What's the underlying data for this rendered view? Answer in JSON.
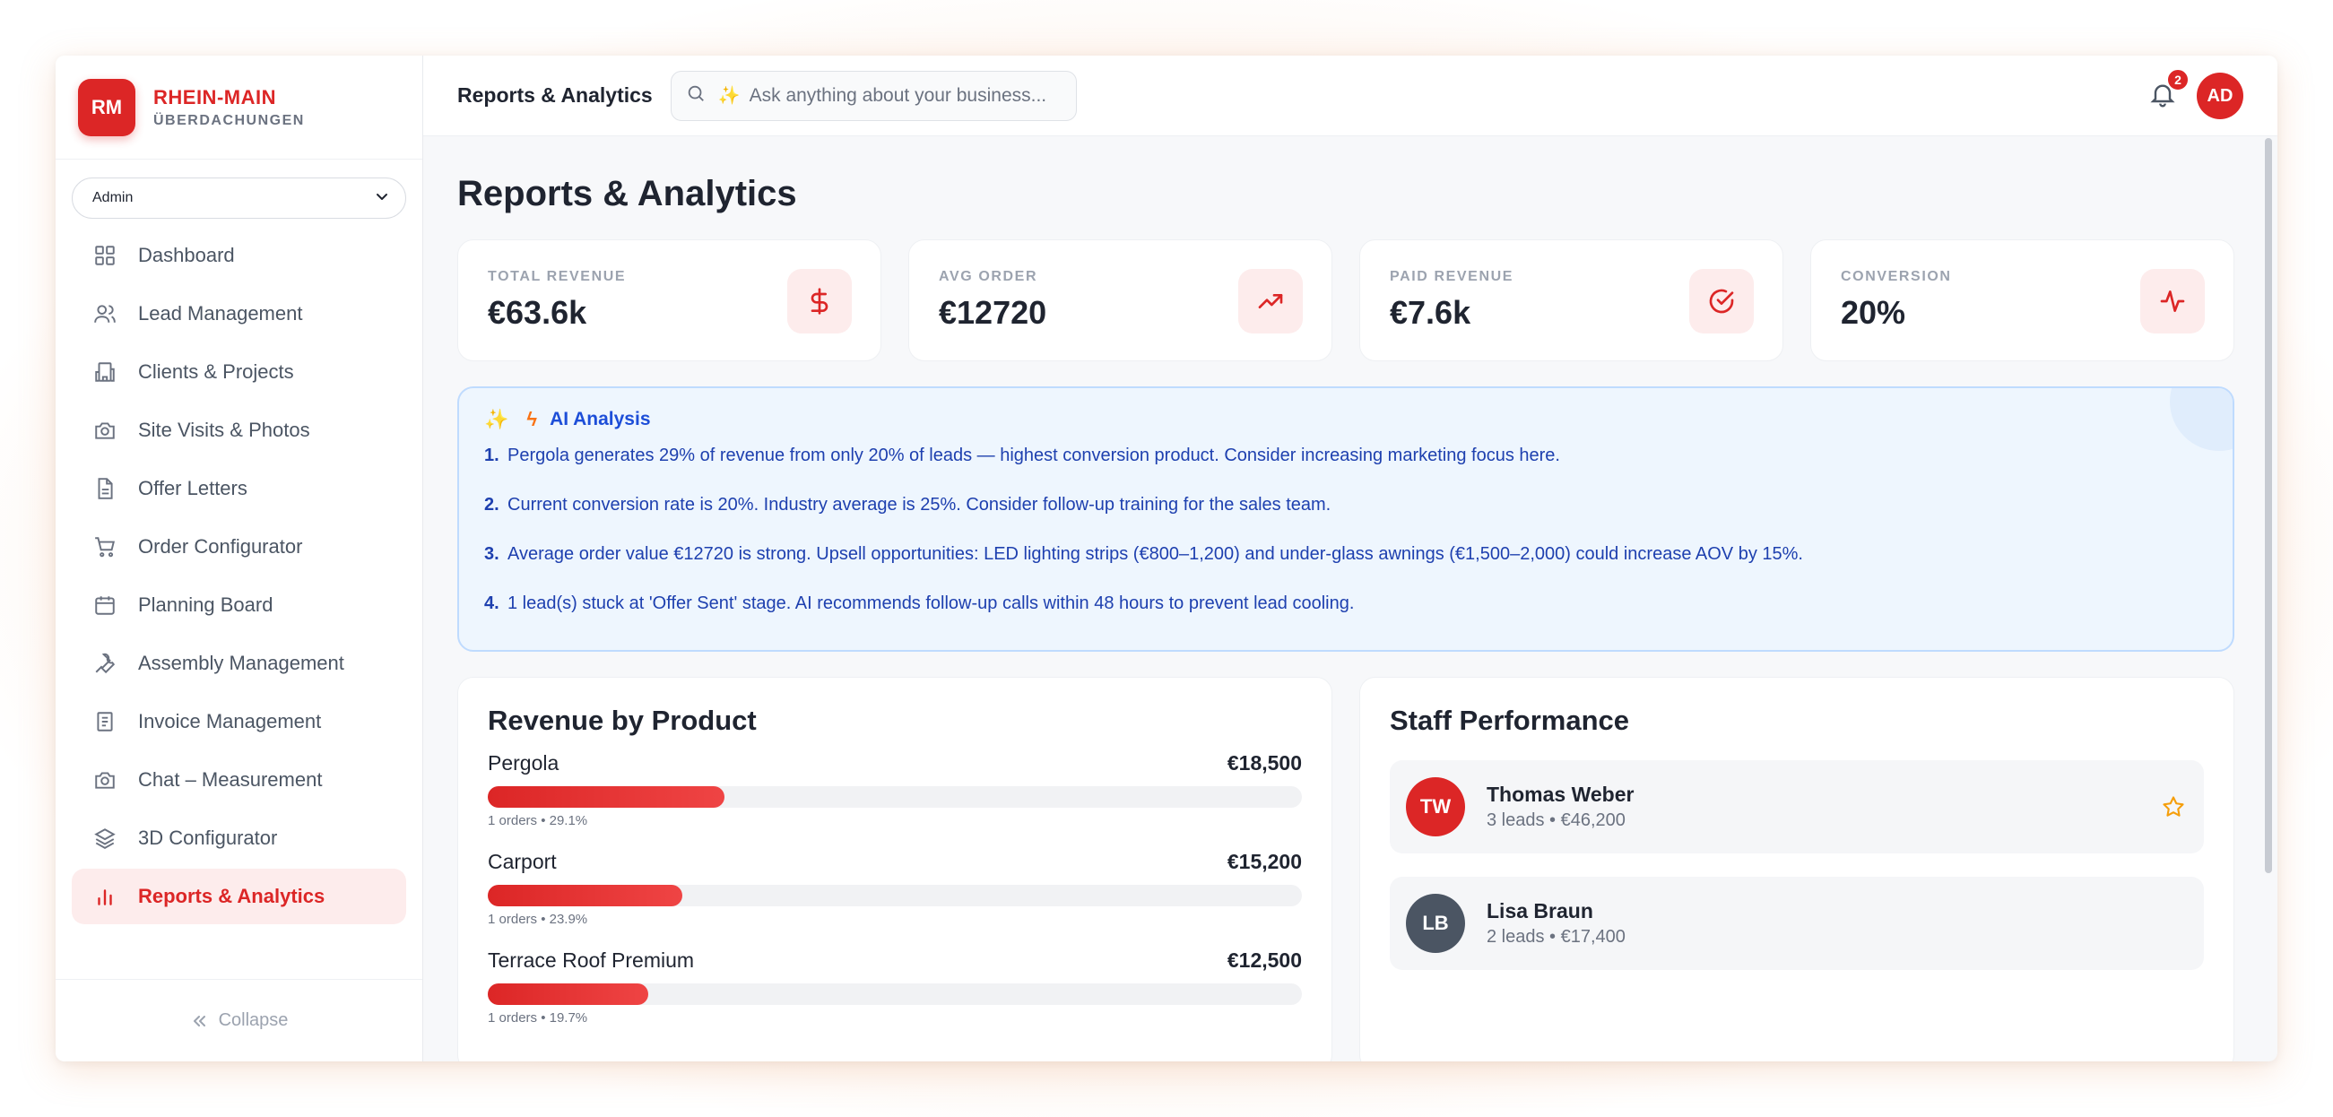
{
  "brand": {
    "initials": "RM",
    "name": "RHEIN-MAIN",
    "subtitle": "ÜBERDACHUNGEN"
  },
  "role": {
    "selected": "Admin"
  },
  "sidebar": {
    "items": [
      {
        "label": "Dashboard",
        "icon": "grid-icon"
      },
      {
        "label": "Lead Management",
        "icon": "users-icon"
      },
      {
        "label": "Clients & Projects",
        "icon": "building-icon"
      },
      {
        "label": "Site Visits & Photos",
        "icon": "camera-icon"
      },
      {
        "label": "Offer Letters",
        "icon": "document-icon"
      },
      {
        "label": "Order Configurator",
        "icon": "cart-icon"
      },
      {
        "label": "Planning Board",
        "icon": "calendar-icon"
      },
      {
        "label": "Assembly Management",
        "icon": "wrench-icon"
      },
      {
        "label": "Invoice Management",
        "icon": "receipt-icon"
      },
      {
        "label": "Chat – Measurement",
        "icon": "camera-icon"
      },
      {
        "label": "3D Configurator",
        "icon": "layers-icon"
      },
      {
        "label": "Reports & Analytics",
        "icon": "bar-chart-icon",
        "active": true
      }
    ],
    "collapse_label": "Collapse"
  },
  "topbar": {
    "title": "Reports & Analytics",
    "search_placeholder": "Ask anything about your business...",
    "notifications": "2",
    "user_initials": "AD"
  },
  "page": {
    "title": "Reports & Analytics"
  },
  "stats": [
    {
      "label": "TOTAL REVENUE",
      "value": "€63.6k",
      "icon": "dollar-icon"
    },
    {
      "label": "AVG ORDER",
      "value": "€12720",
      "icon": "trending-up-icon"
    },
    {
      "label": "PAID REVENUE",
      "value": "€7.6k",
      "icon": "check-circle-icon"
    },
    {
      "label": "CONVERSION",
      "value": "20%",
      "icon": "activity-icon"
    }
  ],
  "ai": {
    "title": "AI Analysis",
    "items": [
      {
        "num": "1.",
        "text": "Pergola generates 29% of revenue from only 20% of leads — highest conversion product. Consider increasing marketing focus here."
      },
      {
        "num": "2.",
        "text": "Current conversion rate is 20%. Industry average is 25%. Consider follow-up training for the sales team."
      },
      {
        "num": "3.",
        "text": "Average order value €12720 is strong. Upsell opportunities: LED lighting strips (€800–1,200) and under-glass awnings (€1,500–2,000) could increase AOV by 15%."
      },
      {
        "num": "4.",
        "text": "1 lead(s) stuck at 'Offer Sent' stage. AI recommends follow-up calls within 48 hours to prevent lead cooling."
      }
    ]
  },
  "revenue": {
    "title": "Revenue by Product",
    "items": [
      {
        "name": "Pergola",
        "amount": "€18,500",
        "meta": "1 orders • 29.1%",
        "share": 0.291
      },
      {
        "name": "Carport",
        "amount": "€15,200",
        "meta": "1 orders • 23.9%",
        "share": 0.239
      },
      {
        "name": "Terrace Roof Premium",
        "amount": "€12,500",
        "meta": "1 orders • 19.7%",
        "share": 0.197
      }
    ]
  },
  "staff": {
    "title": "Staff Performance",
    "members": [
      {
        "initials": "TW",
        "name": "Thomas Weber",
        "meta": "3 leads • €46,200",
        "color": "#dc2626",
        "starred": true
      },
      {
        "initials": "LB",
        "name": "Lisa Braun",
        "meta": "2 leads • €17,400",
        "color": "#4b5563",
        "starred": false
      }
    ]
  },
  "colors": {
    "accent": "#dc2626",
    "ai_text": "#1e40af",
    "ai_bg": "#eef6fe"
  }
}
